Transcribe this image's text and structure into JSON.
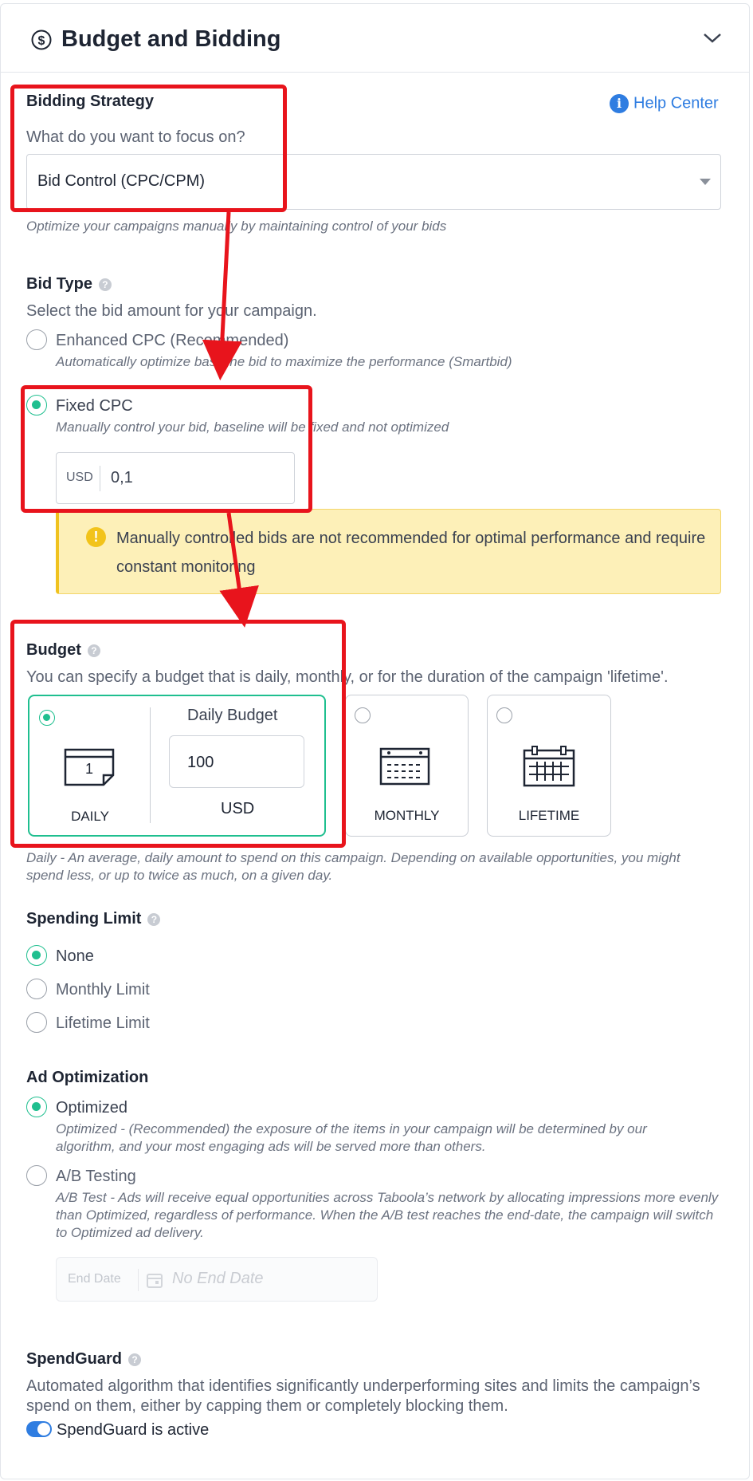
{
  "header": {
    "title": "Budget and Bidding"
  },
  "bidding": {
    "label": "Bidding Strategy",
    "help_center": "Help Center",
    "question": "What do you want to focus on?",
    "selected": "Bid Control (CPC/CPM)",
    "hint": "Optimize your campaigns manually by maintaining control of your bids"
  },
  "bid_type": {
    "label": "Bid Type",
    "desc": "Select the bid amount for your campaign.",
    "options": [
      {
        "label": "Enhanced CPC (Recommended)",
        "hint": "Automatically optimize baseline bid to maximize the performance (Smartbid)",
        "selected": false
      },
      {
        "label": "Fixed CPC",
        "hint": "Manually control your bid, baseline will be fixed and not optimized",
        "selected": true
      }
    ],
    "currency": "USD",
    "amount": "0,1",
    "warning": "Manually controlled bids are not recommended for optimal performance and require constant monitoring"
  },
  "budget": {
    "label": "Budget",
    "desc": "You can specify a budget that is daily, monthly, or for the duration of the campaign 'lifetime'.",
    "cards": [
      {
        "label": "DAILY",
        "icon": "calendar-day-icon",
        "selected": true
      },
      {
        "label": "MONTHLY",
        "icon": "calendar-month-icon",
        "selected": false
      },
      {
        "label": "LIFETIME",
        "icon": "calendar-lifetime-icon",
        "selected": false
      }
    ],
    "daily_title": "Daily Budget",
    "daily_value": "100",
    "daily_currency": "USD",
    "day_number": "1",
    "hint": "Daily - An average, daily amount to spend on this campaign. Depending on available opportunities, you might spend less, or up to twice as much, on a given day."
  },
  "spending_limit": {
    "label": "Spending Limit",
    "options": [
      {
        "label": "None",
        "selected": true
      },
      {
        "label": "Monthly Limit",
        "selected": false
      },
      {
        "label": "Lifetime Limit",
        "selected": false
      }
    ]
  },
  "ad_optimization": {
    "label": "Ad Optimization",
    "options": [
      {
        "label": "Optimized",
        "hint": "Optimized - (Recommended) the exposure of the items in your campaign will be determined by our algorithm, and your most engaging ads will be served more than others.",
        "selected": true
      },
      {
        "label": "A/B Testing",
        "hint": "A/B Test - Ads will receive equal opportunities across Taboola’s network by allocating impressions more evenly than Optimized, regardless of performance. When the A/B test reaches the end-date, the campaign will switch to Optimized ad delivery.",
        "selected": false
      }
    ],
    "end_date_label": "End Date",
    "end_date_placeholder": "No End Date"
  },
  "spendguard": {
    "label": "SpendGuard",
    "desc": "Automated algorithm that identifies significantly underperforming sites and limits the campaign’s spend on them, either by capping them or completely blocking them.",
    "toggle_label": "SpendGuard is active",
    "active": true
  },
  "colors": {
    "accent": "#1fbf8f",
    "link": "#2f7de1",
    "annotation": "#e8141c",
    "warning_bg": "#fdf0b8"
  }
}
